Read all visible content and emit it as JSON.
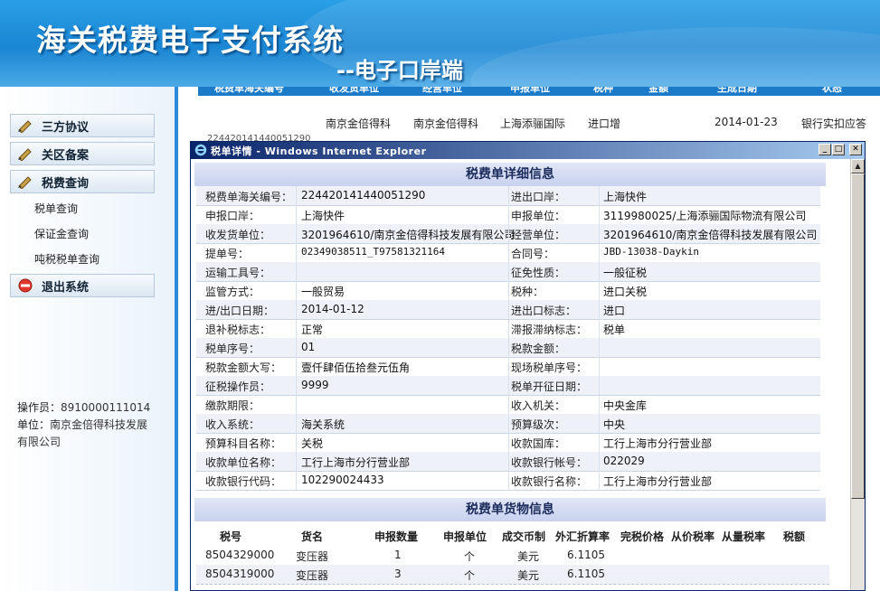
{
  "header": {
    "title": "海关税费电子支付系统",
    "subtitle": "--电子口岸端"
  },
  "sidebar": {
    "items": [
      {
        "label": "三方协议"
      },
      {
        "label": "关区备案"
      },
      {
        "label": "税费查询"
      }
    ],
    "sub_items": [
      "税单查询",
      "保证金查询",
      "吨税税单查询"
    ],
    "logout": "退出系统",
    "operator_label": "操作员：",
    "operator_value": "8910000111014",
    "unit_label": "单位：",
    "unit_value": "南京金倍得科技发展有限公司"
  },
  "bg_table": {
    "headers": [
      "税费单海关编号",
      "收发货单位",
      "经营单位",
      "申报单位",
      "税种",
      "金额",
      "生成日期",
      "状态"
    ],
    "row": [
      "224420141440051290",
      "南京金倍得科",
      "南京金倍得科",
      "上海添骊国际",
      "进口增",
      "",
      "2014-01-23",
      "银行实扣应答"
    ]
  },
  "popup": {
    "title": "税单详情 - Windows Internet Explorer",
    "detail_title": "税费单详细信息",
    "fields": [
      {
        "l1": "税费单海关编号：",
        "v1": "224420141440051290",
        "l2": "进出口岸：",
        "v2": "上海快件"
      },
      {
        "l1": "申报口岸：",
        "v1": "上海快件",
        "l2": "申报单位：",
        "v2": "3119980025/上海添骊国际物流有限公司"
      },
      {
        "l1": "收发货单位：",
        "v1": "3201964610/南京金倍得科技发展有限公司",
        "l2": "经营单位：",
        "v2": "3201964610/南京金倍得科技发展有限公司"
      },
      {
        "l1": "提单号：",
        "v1": "02349038511_T97581321164",
        "l2": "合同号：",
        "v2": "JBD-13038-Daykin"
      },
      {
        "l1": "运输工具号：",
        "v1": "",
        "l2": "征免性质：",
        "v2": "一般征税"
      },
      {
        "l1": "监管方式：",
        "v1": "一般贸易",
        "l2": "税种：",
        "v2": "进口关税"
      },
      {
        "l1": "进/出口日期：",
        "v1": "2014-01-12",
        "l2": "进出口标志：",
        "v2": "进口"
      },
      {
        "l1": "退补税标志：",
        "v1": "正常",
        "l2": "滞报滞纳标志：",
        "v2": "税单"
      },
      {
        "l1": "税单序号：",
        "v1": "01",
        "l2": "税款金额：",
        "v2": ""
      },
      {
        "l1": "税款金额大写：",
        "v1": "壹仟肆佰伍拾叁元伍角",
        "l2": "现场税单序号：",
        "v2": ""
      },
      {
        "l1": "征税操作员：",
        "v1": "9999",
        "l2": "税单开征日期：",
        "v2": ""
      },
      {
        "l1": "缴款期限：",
        "v1": "",
        "l2": "收入机关：",
        "v2": "中央金库"
      },
      {
        "l1": "收入系统：",
        "v1": "海关系统",
        "l2": "预算级次：",
        "v2": "中央"
      },
      {
        "l1": "预算科目名称：",
        "v1": "关税",
        "l2": "收款国库：",
        "v2": "工行上海市分行营业部"
      },
      {
        "l1": "收款单位名称：",
        "v1": "工行上海市分行营业部",
        "l2": "收款银行帐号：",
        "v2": "022029"
      },
      {
        "l1": "收款银行代码：",
        "v1": "102290024433",
        "l2": "收款银行名称：",
        "v2": "工行上海市分行营业部"
      }
    ],
    "goods_title": "税费单货物信息",
    "goods_headers": [
      "税号",
      "货名",
      "申报数量",
      "申报单位",
      "成交币制",
      "外汇折算率",
      "完税价格",
      "从价税率",
      "从量税率",
      "税额"
    ],
    "goods_rows": [
      [
        "8504329000",
        "变压器",
        "1",
        "个",
        "美元",
        "6.1105",
        "",
        "",
        "",
        ""
      ],
      [
        "8504319000",
        "变压器",
        "3",
        "个",
        "美元",
        "6.1105",
        "",
        "",
        "",
        ""
      ]
    ]
  }
}
